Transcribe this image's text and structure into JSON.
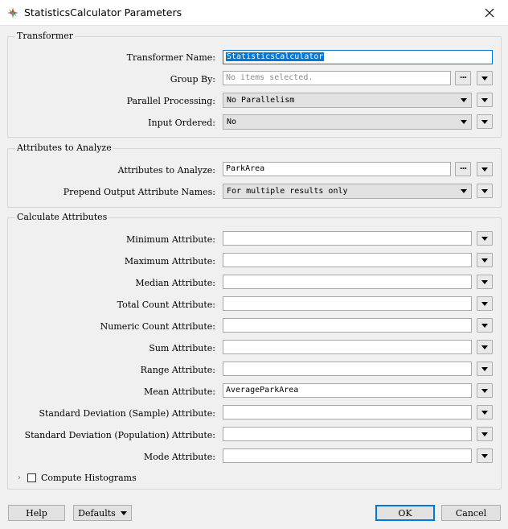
{
  "window": {
    "title": "StatisticsCalculator Parameters"
  },
  "transformer": {
    "title": "Transformer",
    "name_label": "Transformer Name:",
    "name_value": "StatisticsCalculator",
    "group_by_label": "Group By:",
    "group_by_placeholder": "No items selected.",
    "parallel_label": "Parallel Processing:",
    "parallel_value": "No Parallelism",
    "input_ordered_label": "Input Ordered:",
    "input_ordered_value": "No"
  },
  "analyze": {
    "title": "Attributes to Analyze",
    "attrs_label": "Attributes to Analyze:",
    "attrs_value": "ParkArea",
    "prepend_label": "Prepend Output Attribute Names:",
    "prepend_value": "For multiple results only"
  },
  "calculate": {
    "title": "Calculate Attributes",
    "rows": [
      {
        "label": "Minimum Attribute:",
        "value": ""
      },
      {
        "label": "Maximum Attribute:",
        "value": ""
      },
      {
        "label": "Median Attribute:",
        "value": ""
      },
      {
        "label": "Total Count Attribute:",
        "value": ""
      },
      {
        "label": "Numeric Count Attribute:",
        "value": ""
      },
      {
        "label": "Sum Attribute:",
        "value": ""
      },
      {
        "label": "Range Attribute:",
        "value": ""
      },
      {
        "label": "Mean Attribute:",
        "value": "AverageParkArea"
      },
      {
        "label": "Standard Deviation (Sample) Attribute:",
        "value": ""
      },
      {
        "label": "Standard Deviation (Population) Attribute:",
        "value": ""
      },
      {
        "label": "Mode Attribute:",
        "value": ""
      }
    ],
    "histogram_label": "Compute Histograms",
    "histogram_checked": false
  },
  "buttons": {
    "help": "Help",
    "defaults": "Defaults",
    "ok": "OK",
    "cancel": "Cancel"
  },
  "icons": {
    "app": "fme-transformer-icon",
    "close": "close-icon",
    "dropdown": "chevron-down-icon",
    "ellipsis": "ellipsis-icon"
  }
}
